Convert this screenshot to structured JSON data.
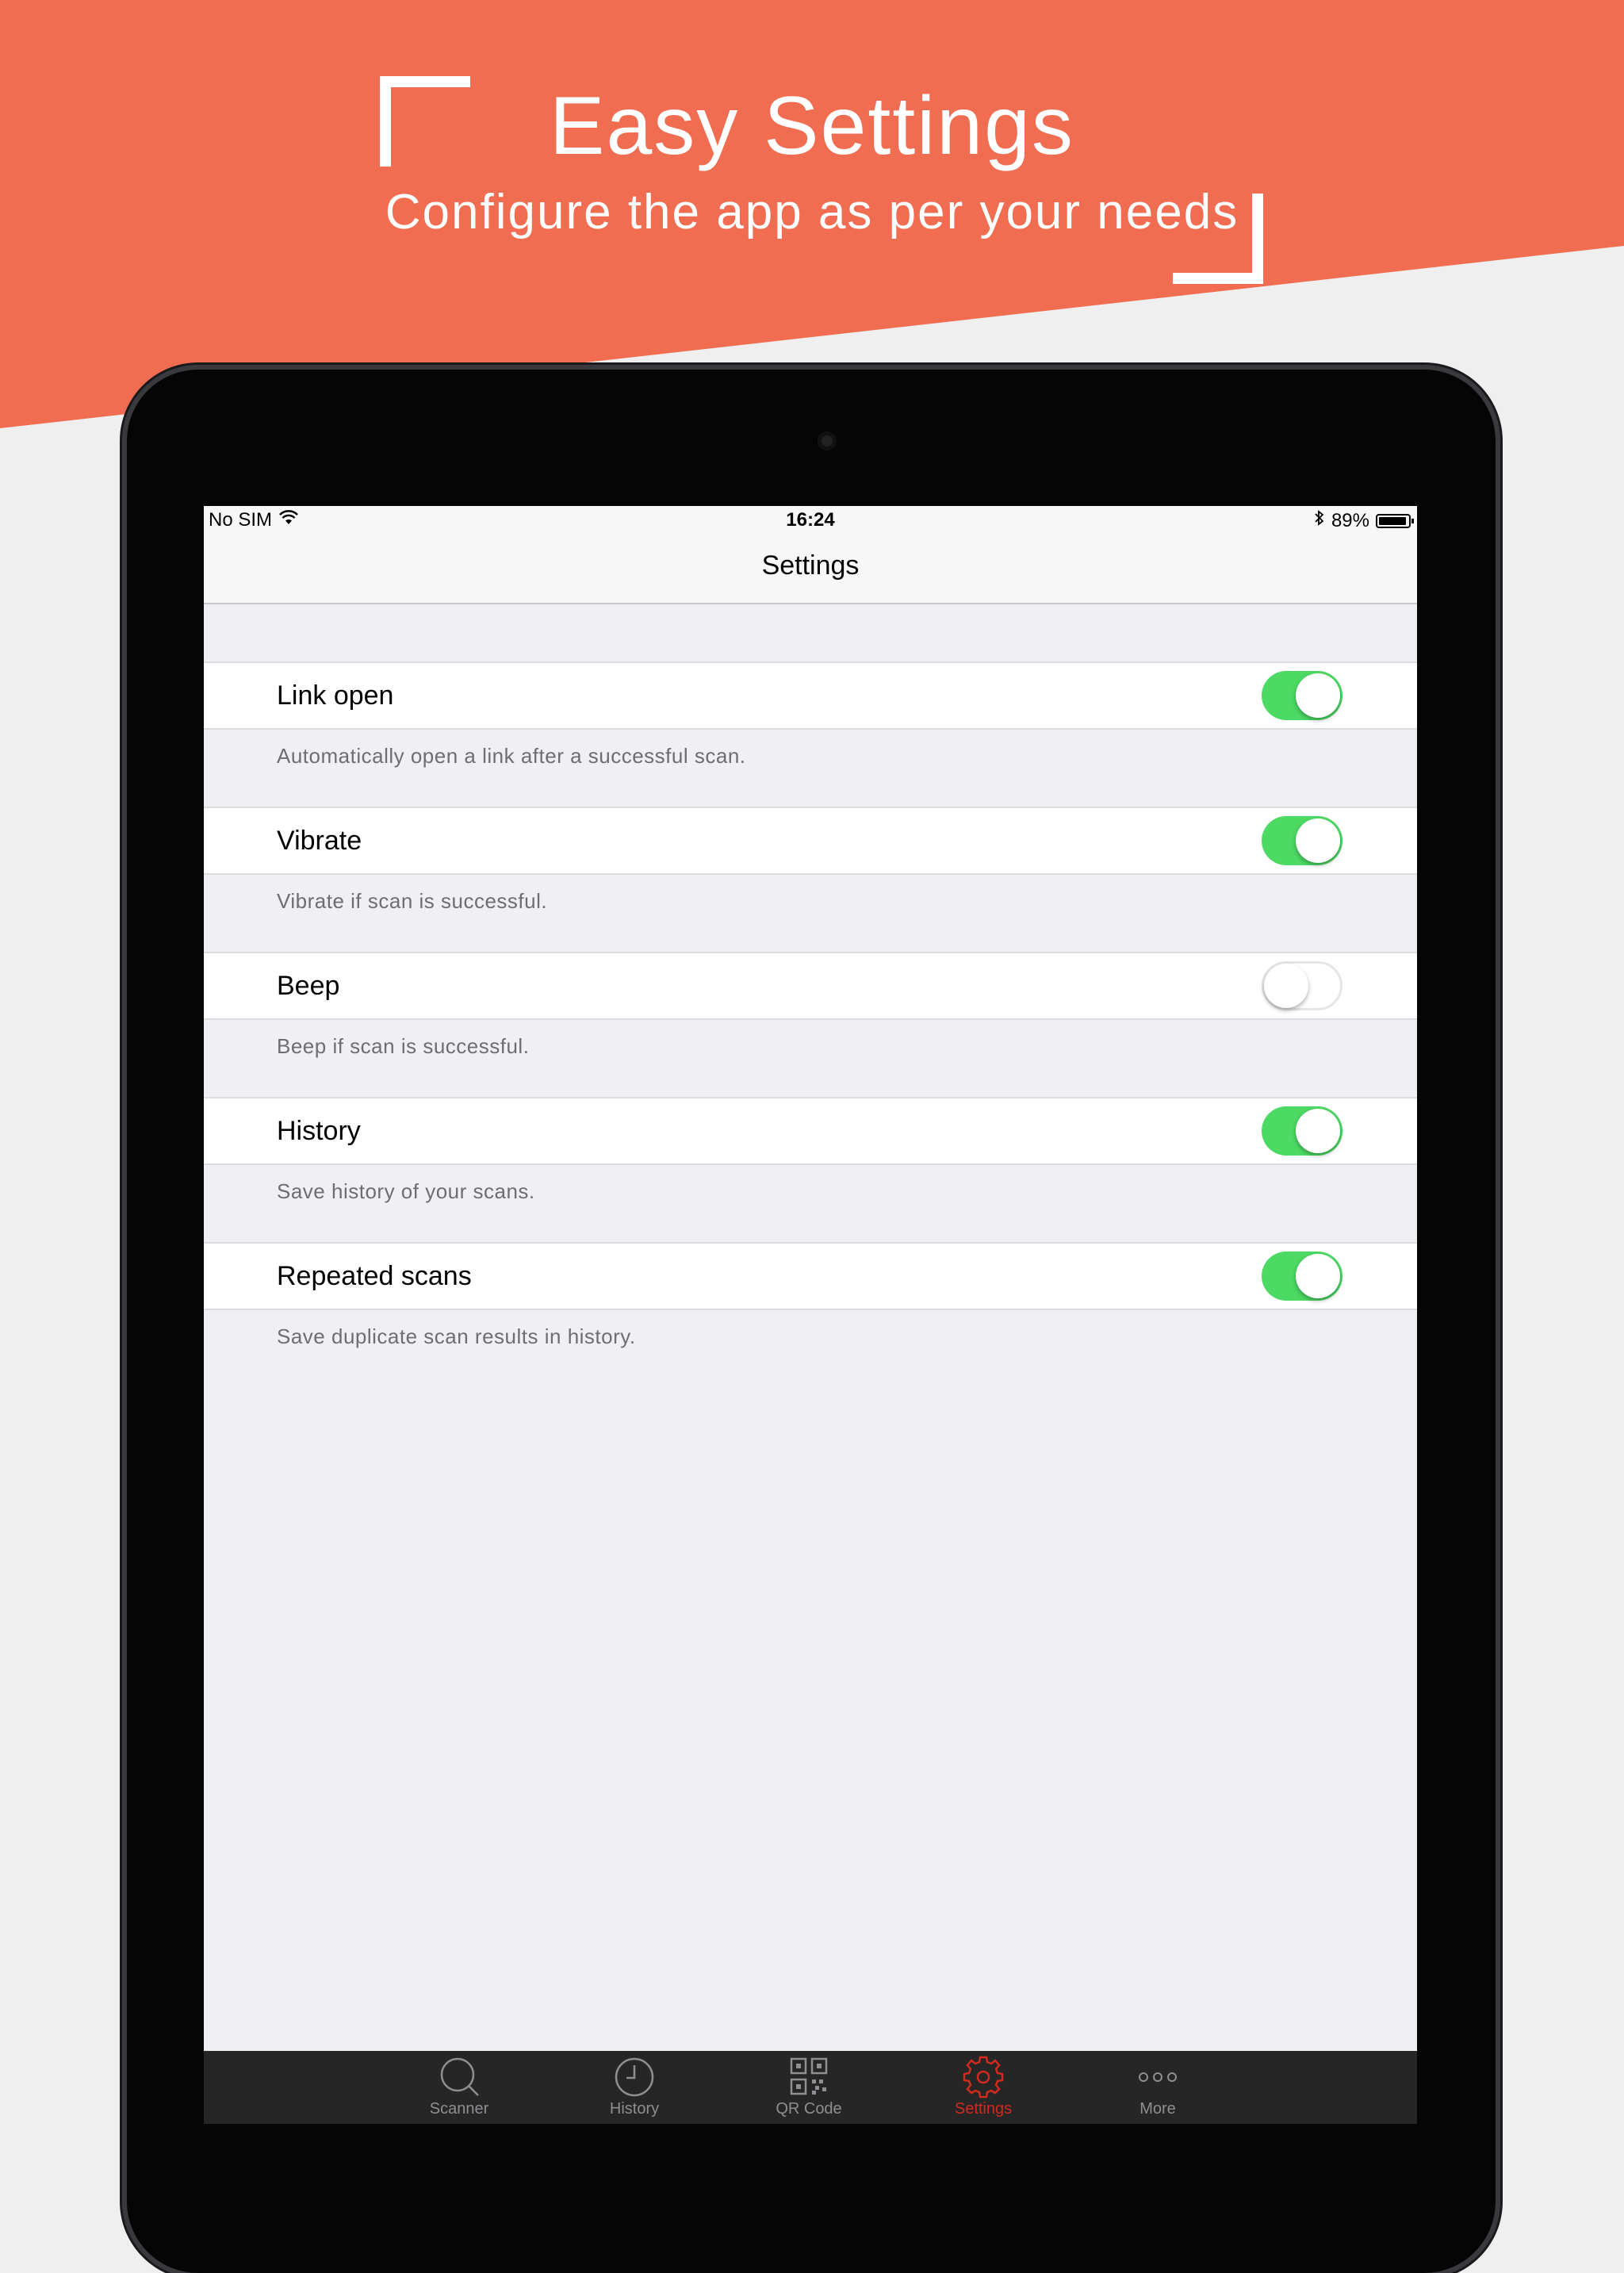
{
  "promo": {
    "title": "Easy Settings",
    "subtitle": "Configure the app as per your needs"
  },
  "status_bar": {
    "carrier": "No SIM",
    "time": "16:24",
    "battery": "89%"
  },
  "nav": {
    "title": "Settings"
  },
  "settings": [
    {
      "label": "Link open",
      "description": "Automatically open a link after a successful scan.",
      "enabled": true
    },
    {
      "label": "Vibrate",
      "description": "Vibrate if scan is successful.",
      "enabled": true
    },
    {
      "label": "Beep",
      "description": "Beep if scan is successful.",
      "enabled": false
    },
    {
      "label": "History",
      "description": "Save history of your scans.",
      "enabled": true
    },
    {
      "label": "Repeated scans",
      "description": "Save duplicate scan results in history.",
      "enabled": true
    }
  ],
  "tabs": [
    {
      "label": "Scanner",
      "icon": "search-icon"
    },
    {
      "label": "History",
      "icon": "clock-icon"
    },
    {
      "label": "QR Code",
      "icon": "qr-code-icon"
    },
    {
      "label": "Settings",
      "icon": "gear-icon",
      "active": true
    },
    {
      "label": "More",
      "icon": "more-icon"
    }
  ],
  "colors": {
    "banner": "#f16d51",
    "toggle_on": "#4cd964",
    "active_tab": "#d32a1e"
  }
}
